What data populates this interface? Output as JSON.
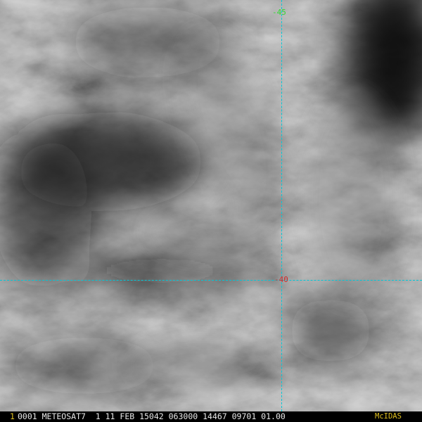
{
  "overlay": {
    "longitude_label": "-45",
    "latitude_label": "-40",
    "crosshair_color": "#00c8d8",
    "longitude_label_color": "#34d934",
    "latitude_label_color": "#d02a2a"
  },
  "status_bar": {
    "frame_number": "1",
    "info_text": "0001 METEOSAT7  1 11 FEB 15042 063000 14467 09701 01.00",
    "software_label": "McIDAS",
    "accent_color": "#e0c020"
  }
}
